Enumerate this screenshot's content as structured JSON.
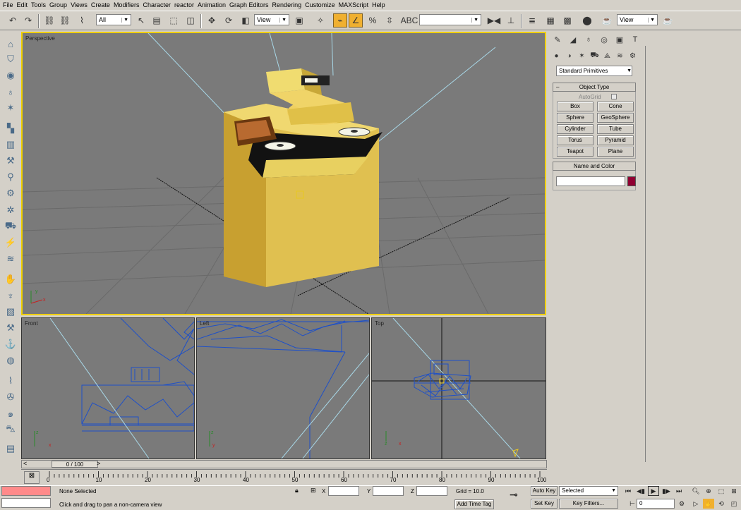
{
  "menu": [
    "File",
    "Edit",
    "Tools",
    "Group",
    "Views",
    "Create",
    "Modifiers",
    "Character",
    "reactor",
    "Animation",
    "Graph Editors",
    "Rendering",
    "Customize",
    "MAXScript",
    "Help"
  ],
  "toolbar": {
    "filter_select": "All",
    "ref_coord_select": "View",
    "named_selection": "",
    "right_view_select": "View"
  },
  "viewports": {
    "perspective": "Perspective",
    "front": "Front",
    "left": "Left",
    "top": "Top"
  },
  "axis_labels": {
    "x": "x",
    "y": "y",
    "z": "z"
  },
  "command_panel": {
    "category_select": "Standard Primitives",
    "object_type_header": "Object Type",
    "autogrid_label": "AutoGrid",
    "buttons": [
      "Box",
      "Cone",
      "Sphere",
      "GeoSphere",
      "Cylinder",
      "Tube",
      "Torus",
      "Pyramid",
      "Teapot",
      "Plane"
    ],
    "name_color_header": "Name and Color",
    "name_value": "",
    "object_color": "#900032"
  },
  "time_slider": {
    "label": "0 / 100",
    "current": 0,
    "max": 100
  },
  "track_ticks": [
    "0",
    "10",
    "20",
    "30",
    "40",
    "50",
    "60",
    "70",
    "80",
    "90",
    "100"
  ],
  "status": {
    "selection": "None Selected",
    "prompt": "Click and drag to pan a non-camera view",
    "x_label": "X",
    "y_label": "Y",
    "z_label": "Z",
    "x_value": "",
    "y_value": "",
    "z_value": "",
    "grid": "Grid = 10.0",
    "add_time_tag": "Add Time Tag",
    "auto_key": "Auto Key",
    "set_key": "Set Key",
    "key_mode_select": "Selected",
    "key_filters": "Key Filters...",
    "frame_value": "0"
  },
  "colors": {
    "accent_active": "#f0b030",
    "viewport_bg": "#7a7a7a",
    "viewport_active_border": "#f0d000",
    "wire_blue": "#1e50c8",
    "object_yellow": "#e8c848"
  }
}
